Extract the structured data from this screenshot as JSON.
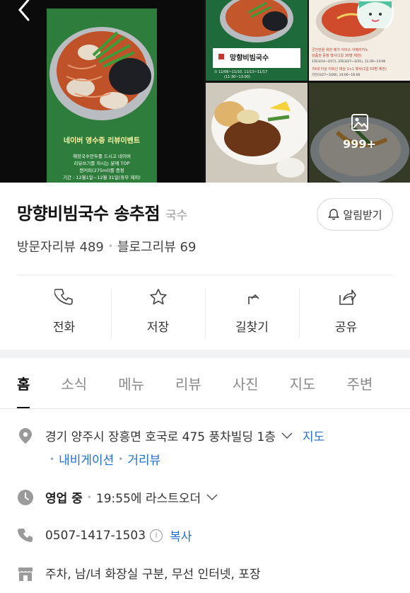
{
  "gallery": {
    "poster_title": "네이버 영수증 리뷰이벤트",
    "poster_text": "해장국수만두를 드시고 네이버\n리뷰쓰기를 하시는 분께 TOP\n캔커피(275ml)를 증정\n기간 : 12월1일~12월 31일(휴무 제외)",
    "shop_sign": "망향비빔국수",
    "sign_dates": "① 11/06~11/10, 11/13~11/17\n(11:30~13:00)",
    "event_text": "군인만을 위한 메가 아이스 아메리카노\n상품권 증정 행사(1일 30명 제한)\n1차(3/14~3/17), 2차(3/27~3/31), 11:30~13:00\n70세 이상 어르신 대상 1+1 행사(1일 50명 제한)\n기간(3/27~3/28), 14:00~16:00",
    "more_count": "999+"
  },
  "place": {
    "name": "망향비빔국수 송추점",
    "category": "국수",
    "alarm_label": "알림받기",
    "visitor_reviews": "방문자리뷰 489",
    "blog_reviews": "블로그리뷰 69"
  },
  "actions": [
    {
      "label": "전화",
      "icon": "phone-icon"
    },
    {
      "label": "저장",
      "icon": "star-icon"
    },
    {
      "label": "길찾기",
      "icon": "directions-icon"
    },
    {
      "label": "공유",
      "icon": "share-icon"
    }
  ],
  "tabs": [
    "홈",
    "소식",
    "메뉴",
    "리뷰",
    "사진",
    "지도",
    "주변"
  ],
  "info": {
    "address": "경기 양주시 장흥면 호국로 475 풍차빌딩 1층",
    "map_link": "지도",
    "navigation": "내비게이션",
    "street_view": "거리뷰",
    "status": "영업 중",
    "last_order": "19:55에 라스트오더",
    "phone": "0507-1417-1503",
    "copy": "복사",
    "amenities": "주차, 남/녀 화장실 구분, 무선 인터넷, 포장"
  },
  "colors": {
    "link": "#1f6fd6",
    "tab_active": "#111111",
    "poster_bg": "#2e7d3c"
  }
}
